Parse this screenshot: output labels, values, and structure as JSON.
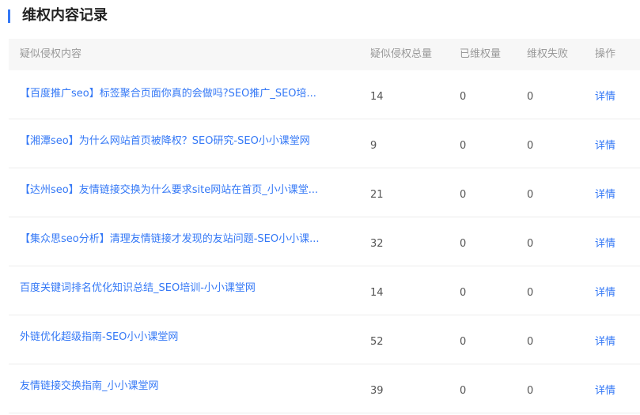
{
  "section": {
    "title": "维权内容记录"
  },
  "table": {
    "headers": {
      "title": "疑似侵权内容",
      "total": "疑似侵权总量",
      "done": "已维权量",
      "fail": "维权失败",
      "op": "操作"
    },
    "rows": [
      {
        "title": "【百度推广seo】标签聚合页面你真的会做吗?SEO推广_SEO培...",
        "total": "14",
        "done": "0",
        "fail": "0",
        "op": "详情"
      },
      {
        "title": "【湘潭seo】为什么网站首页被降权？SEO研究-SEO小小课堂网",
        "total": "9",
        "done": "0",
        "fail": "0",
        "op": "详情"
      },
      {
        "title": "【达州seo】友情链接交换为什么要求site网站在首页_小小课堂...",
        "total": "21",
        "done": "0",
        "fail": "0",
        "op": "详情"
      },
      {
        "title": "【集众思seo分析】清理友情链接才发现的友站问题-SEO小小课...",
        "total": "32",
        "done": "0",
        "fail": "0",
        "op": "详情"
      },
      {
        "title": "百度关键词排名优化知识总结_SEO培训-小小课堂网",
        "total": "14",
        "done": "0",
        "fail": "0",
        "op": "详情"
      },
      {
        "title": "外链优化超级指南-SEO小小课堂网",
        "total": "52",
        "done": "0",
        "fail": "0",
        "op": "详情"
      },
      {
        "title": "友情链接交换指南_小小课堂网",
        "total": "39",
        "done": "0",
        "fail": "0",
        "op": "详情"
      }
    ]
  },
  "colors": {
    "accent": "#3478f6",
    "header_bg": "#f7f7f7",
    "header_text": "#999999",
    "body_text": "#555555",
    "divider": "#ececec"
  }
}
